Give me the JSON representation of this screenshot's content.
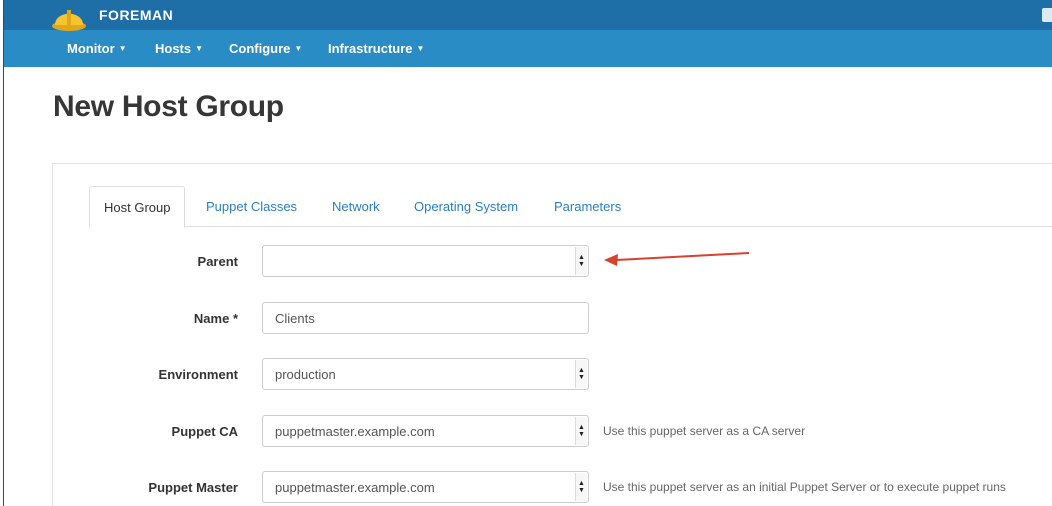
{
  "brand": {
    "name": "FOREMAN"
  },
  "nav": [
    {
      "label": "Monitor"
    },
    {
      "label": "Hosts"
    },
    {
      "label": "Configure"
    },
    {
      "label": "Infrastructure"
    }
  ],
  "page": {
    "title": "New Host Group"
  },
  "tabs": [
    {
      "label": "Host Group",
      "active": true
    },
    {
      "label": "Puppet Classes"
    },
    {
      "label": "Network"
    },
    {
      "label": "Operating System"
    },
    {
      "label": "Parameters"
    }
  ],
  "form": {
    "parent": {
      "label": "Parent",
      "value": ""
    },
    "name": {
      "label": "Name *",
      "value": "Clients"
    },
    "environment": {
      "label": "Environment",
      "value": "production"
    },
    "puppet_ca": {
      "label": "Puppet CA",
      "value": "puppetmaster.example.com",
      "help": "Use this puppet server as a CA server"
    },
    "puppet_master": {
      "label": "Puppet Master",
      "value": "puppetmaster.example.com",
      "help": "Use this puppet server as an initial Puppet Server or to execute puppet runs"
    }
  },
  "colors": {
    "header_dark": "#1e6ea8",
    "header": "#2a8cc4",
    "link": "#2a7fc0",
    "annotation_arrow": "#d9412b"
  },
  "icons": {
    "brand": "hardhat-icon",
    "select": "select-arrows-icon"
  }
}
